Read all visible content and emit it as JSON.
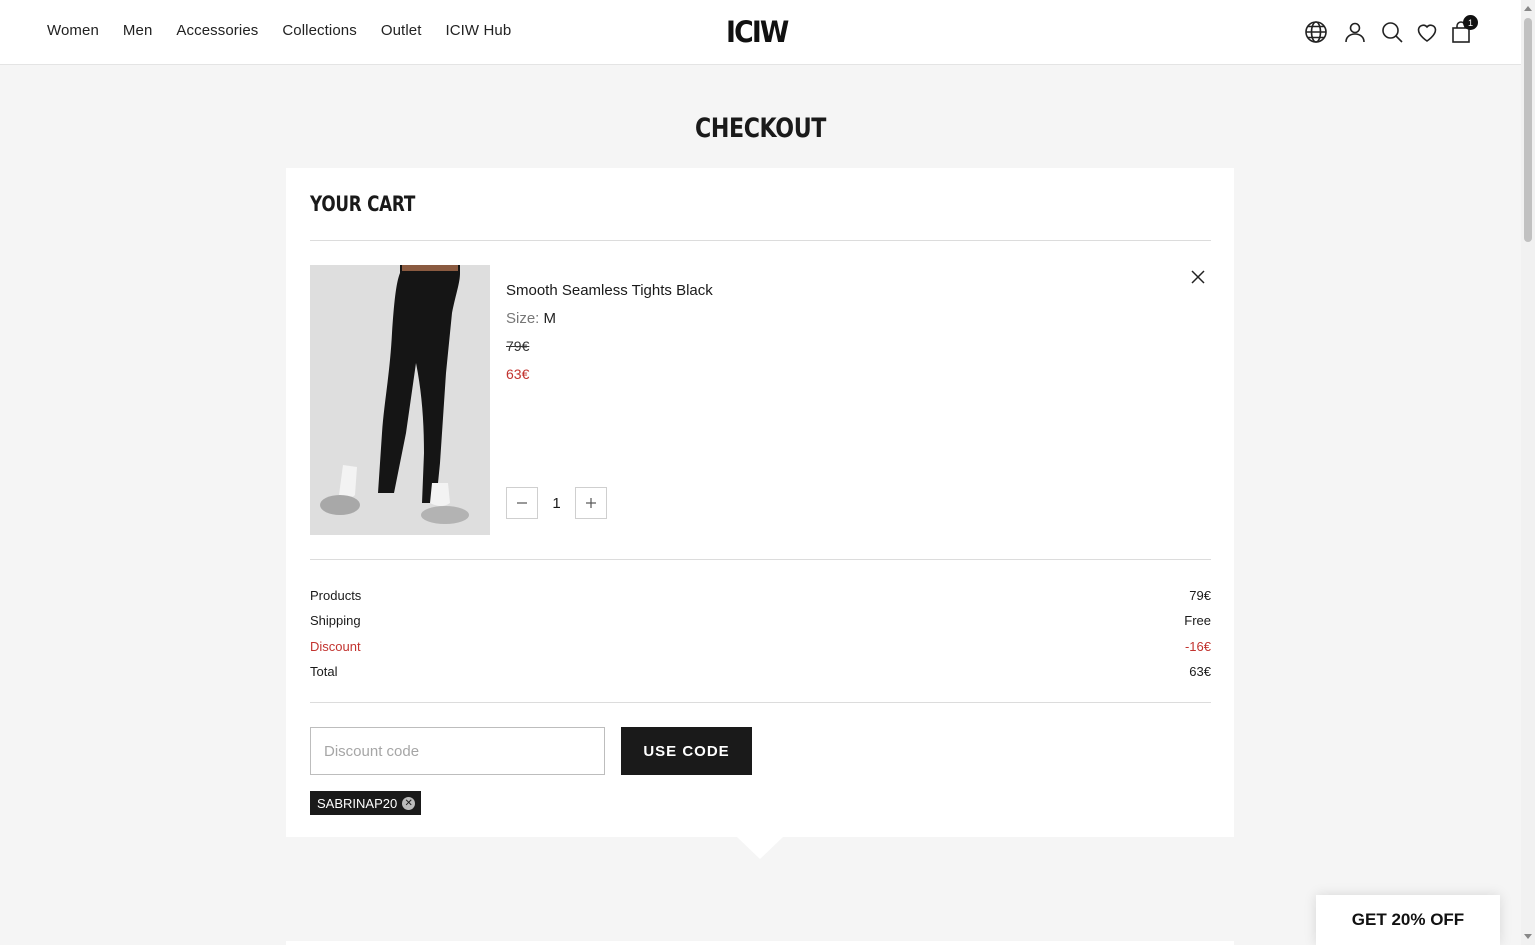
{
  "nav": {
    "items": [
      "Women",
      "Men",
      "Accessories",
      "Collections",
      "Outlet",
      "ICIW Hub"
    ]
  },
  "header": {
    "logo": "ICIW",
    "cart_count": "1"
  },
  "page": {
    "title": "CHECKOUT"
  },
  "cart": {
    "title": "YOUR CART",
    "item": {
      "name": "Smooth Seamless Tights Black",
      "size_label": "Size:",
      "size_value": "M",
      "original_price": "79€",
      "sale_price": "63€",
      "quantity": "1"
    },
    "summary": {
      "products_label": "Products",
      "products_value": "79€",
      "shipping_label": "Shipping",
      "shipping_value": "Free",
      "discount_label": "Discount",
      "discount_value": "-16€",
      "total_label": "Total",
      "total_value": "63€"
    },
    "discount": {
      "placeholder": "Discount code",
      "button_label": "USE CODE",
      "applied_code": "SABRINAP20"
    }
  },
  "promo": {
    "label": "GET 20% OFF"
  },
  "colors": {
    "accent_red": "#c2332f",
    "dark": "#1a1a1a",
    "background": "#f5f5f5"
  }
}
